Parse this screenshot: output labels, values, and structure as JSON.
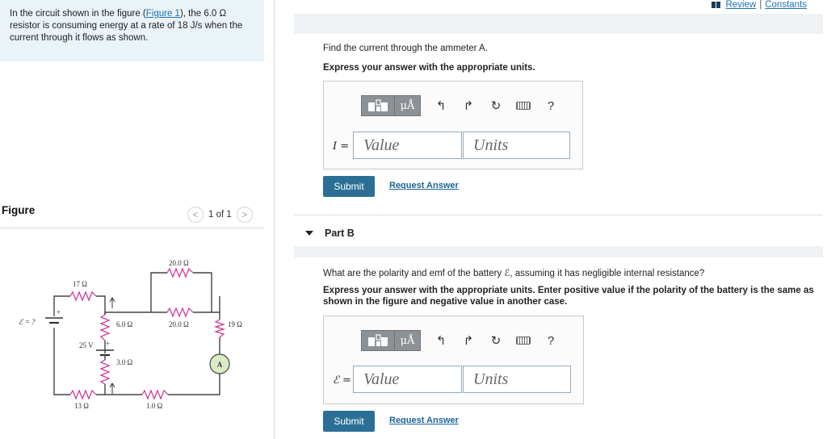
{
  "problem": {
    "text_before_link": "In the circuit shown in the figure (",
    "figure_link": "Figure 1",
    "text_after_link": "), the 6.0 Ω resistor is consuming energy at a rate of 18 J/s when the current through it flows as shown."
  },
  "figure": {
    "title": "Figure",
    "pager_text": "1 of 1",
    "prev_symbol": "<",
    "next_symbol": ">",
    "labels": {
      "emf": "ℰ = ?",
      "r17": "17 Ω",
      "r6": "6.0 Ω",
      "r20a": "20.0 Ω",
      "r20b": "20.0 Ω",
      "r19": "19 Ω",
      "v25": "25 V",
      "r3": "3.0 Ω",
      "r13": "13 Ω",
      "r1": "1.0 Ω",
      "ammeter": "A",
      "plus1": "+",
      "plus2": "+"
    }
  },
  "header": {
    "review": "Review",
    "separator": "|",
    "constants": "Constants"
  },
  "part_a": {
    "prompt": "Find the current through the ammeter A.",
    "instruction": "Express your answer with the appropriate units.",
    "unit_btn": "μÅ",
    "help": "?",
    "var_label": "I =",
    "value_placeholder": "Value",
    "units_placeholder": "Units",
    "submit": "Submit",
    "request": "Request Answer"
  },
  "part_b": {
    "heading": "Part B",
    "prompt": "What are the polarity and emf of the battery ℰ, assuming it has negligible internal resistance?",
    "instruction": "Express your answer with the appropriate units. Enter positive value if the polarity of the battery is the same as shown in the figure and negative value in another case.",
    "unit_btn": "μÅ",
    "help": "?",
    "var_label": "ℰ =",
    "value_placeholder": "Value",
    "units_placeholder": "Units",
    "submit": "Submit",
    "request": "Request Answer"
  },
  "colors": {
    "resistor": "#d0318f",
    "wire": "#444444",
    "link": "#1a73b8",
    "submit_bg": "#2b6f96"
  }
}
